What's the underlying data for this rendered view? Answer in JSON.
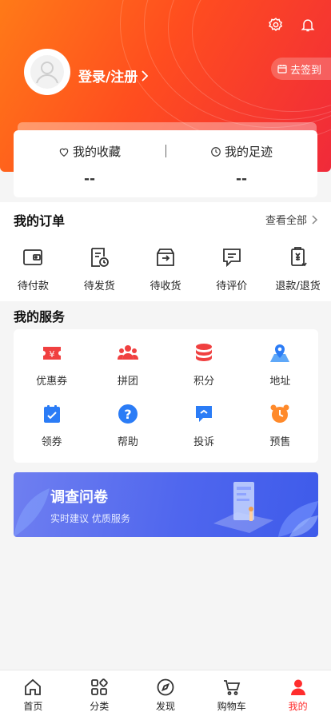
{
  "header": {
    "login_label": "登录/注册",
    "checkin_label": "去签到",
    "icons": [
      "gear-icon",
      "bell-icon",
      "user-icon",
      "calendar-icon"
    ]
  },
  "favorites": {
    "collection_label": "我的收藏",
    "collection_value": "--",
    "footprint_label": "我的足迹",
    "footprint_value": "--"
  },
  "orders": {
    "title": "我的订单",
    "see_all": "查看全部",
    "items": [
      {
        "label": "待付款",
        "icon": "wallet-icon"
      },
      {
        "label": "待发货",
        "icon": "receipt-clock-icon"
      },
      {
        "label": "待收货",
        "icon": "box-icon"
      },
      {
        "label": "待评价",
        "icon": "comment-icon"
      },
      {
        "label": "退款/退货",
        "icon": "refund-icon"
      }
    ]
  },
  "services": {
    "title": "我的服务",
    "items": [
      {
        "label": "优惠券",
        "icon": "coupon-icon"
      },
      {
        "label": "拼团",
        "icon": "group-icon"
      },
      {
        "label": "积分",
        "icon": "coins-icon"
      },
      {
        "label": "地址",
        "icon": "map-pin-icon"
      },
      {
        "label": "领券",
        "icon": "claim-coupon-icon"
      },
      {
        "label": "帮助",
        "icon": "help-icon"
      },
      {
        "label": "投诉",
        "icon": "complaint-icon"
      },
      {
        "label": "预售",
        "icon": "alarm-clock-icon"
      }
    ]
  },
  "banner": {
    "title": "调查问卷",
    "subtitle": "实时建议 优质服务"
  },
  "tabbar": {
    "items": [
      {
        "label": "首页",
        "icon": "home-icon"
      },
      {
        "label": "分类",
        "icon": "category-icon"
      },
      {
        "label": "发现",
        "icon": "compass-icon"
      },
      {
        "label": "购物车",
        "icon": "cart-icon"
      },
      {
        "label": "我的",
        "icon": "profile-icon"
      }
    ],
    "active_index": 4
  },
  "colors": {
    "header_start": "#ff7a18",
    "header_end": "#f02a3a",
    "accent_red": "#ff2d2d",
    "service_red": "#f04040",
    "service_blue": "#2b7cf6",
    "service_orange": "#ff8a2b",
    "banner_blue": "#4f66ee"
  }
}
